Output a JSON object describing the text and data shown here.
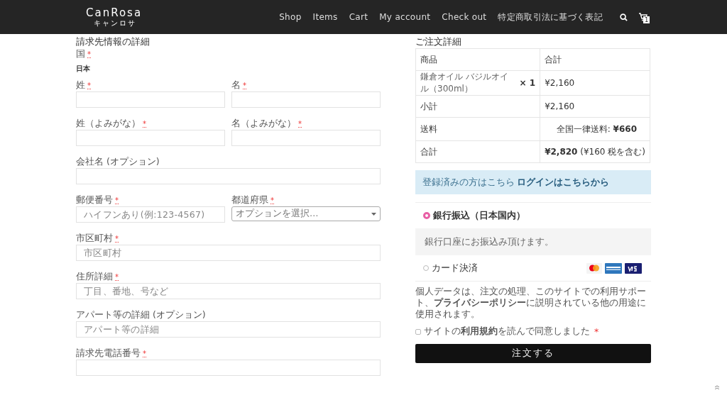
{
  "header": {
    "logo": "CanRosa",
    "logo_sub": "キャンロサ",
    "nav": [
      {
        "label": "Shop"
      },
      {
        "label": "Items"
      },
      {
        "label": "Cart"
      },
      {
        "label": "My account"
      },
      {
        "label": "Check out"
      },
      {
        "label": "特定商取引法に基づく表記"
      }
    ],
    "cart_count": "1"
  },
  "billing": {
    "heading": "請求先情報の詳細",
    "country_label": "国",
    "country_mark": "*",
    "country": "日本",
    "rows": [
      {
        "fields": [
          {
            "label": "姓",
            "mark": "*",
            "kind": "text"
          },
          {
            "label": "名",
            "mark": "*",
            "kind": "text"
          }
        ]
      },
      {
        "fields": [
          {
            "label": "姓（よみがな）",
            "mark": "*",
            "kind": "text"
          },
          {
            "label": "名（よみがな）",
            "mark": "*",
            "kind": "text"
          }
        ]
      },
      {
        "fields": [
          {
            "label": "会社名 (オプション)",
            "kind": "text"
          }
        ]
      },
      {
        "fields": [
          {
            "label": "郵便番号",
            "mark": "*",
            "kind": "text",
            "placeholder": "ハイフンあり(例:123-4567)"
          },
          {
            "label": "都道府県",
            "mark": "*",
            "kind": "select",
            "placeholder": "オプションを選択…"
          }
        ]
      },
      {
        "fields": [
          {
            "label": "市区町村",
            "mark": "*",
            "kind": "text",
            "placeholder": "市区町村"
          }
        ]
      },
      {
        "fields": [
          {
            "label": "住所詳細",
            "mark": "*",
            "kind": "text",
            "placeholder": "丁目、番地、号など"
          }
        ]
      },
      {
        "fields": [
          {
            "label": "アパート等の詳細 (オプション)",
            "kind": "text",
            "placeholder": "アパート等の詳細"
          }
        ]
      },
      {
        "fields": [
          {
            "label": "請求先電話番号",
            "mark": "*",
            "kind": "text"
          }
        ]
      }
    ]
  },
  "order": {
    "heading": "ご注文詳細",
    "columns": [
      "商品",
      "合計"
    ],
    "rows": [
      {
        "cells": [
          "鎌倉オイル バジルオイル（300ml）",
          "¥2,160"
        ],
        "qty": "× 1",
        "kind": "item"
      },
      {
        "cells": [
          "小計",
          "¥2,160"
        ],
        "kind": "plain"
      },
      {
        "cells": [
          "送料",
          "全国一律送料: **¥660**"
        ],
        "kind": "shipping"
      },
      {
        "cells": [
          "合計",
          "**¥2,820** (¥160 税を含む)"
        ],
        "kind": "plain"
      }
    ]
  },
  "notice": {
    "text": "登録済みの方はこちら",
    "link": "ログインはこちらから"
  },
  "payments": [
    {
      "label": "銀行振込（日本国内）",
      "selected": true,
      "kind": "bank",
      "description": "銀行口座にお振込み頂けます。"
    },
    {
      "label": "カード決済",
      "selected": false,
      "kind": "card"
    }
  ],
  "privacy": "個人データは、注文の処理、このサイトでの利用サポート、**プライバシーポリシー**に説明されている他の用途に使用されます。",
  "terms": {
    "text": "サイトの**利用規約**を読んで同意しました",
    "mark": "*",
    "checked": false
  },
  "submit": "注文する"
}
